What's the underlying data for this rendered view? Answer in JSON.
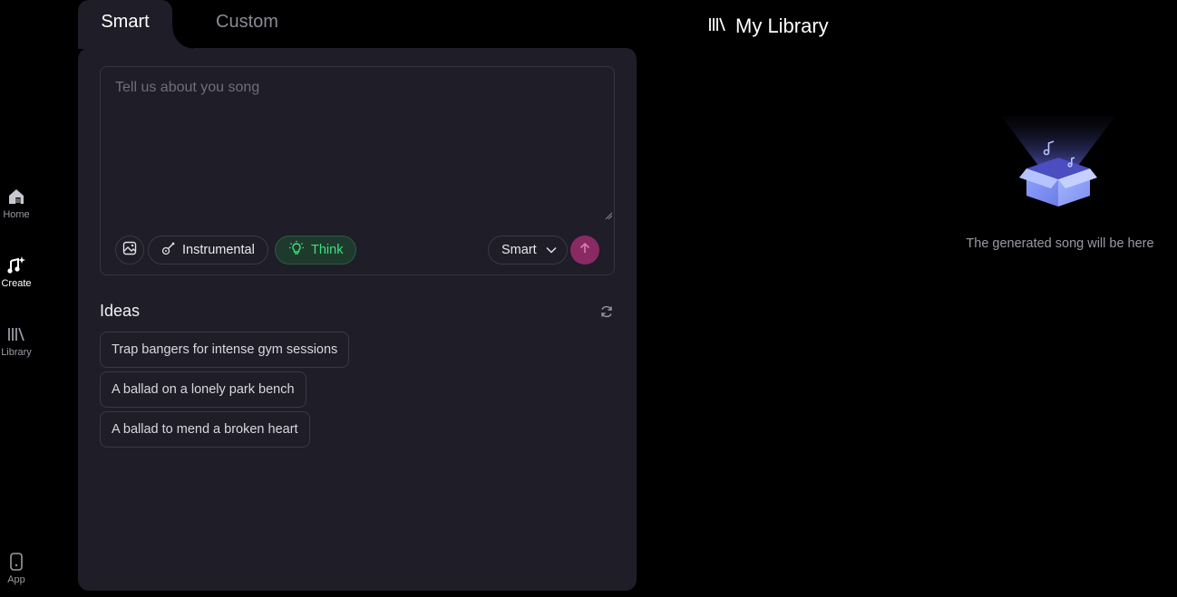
{
  "sidebar": {
    "items": [
      {
        "label": "Home",
        "icon": "home-icon"
      },
      {
        "label": "Create",
        "icon": "music-sparkle-icon",
        "active": true
      },
      {
        "label": "Library",
        "icon": "library-icon"
      },
      {
        "label": "App",
        "icon": "phone-icon"
      }
    ]
  },
  "tabs": {
    "smart": "Smart",
    "custom": "Custom",
    "active": "Smart"
  },
  "prompt": {
    "placeholder": "Tell us about you song",
    "value": ""
  },
  "toolbar": {
    "image_icon": "image-icon",
    "instrumental_label": "Instrumental",
    "think_label": "Think",
    "mode_label": "Smart",
    "send_icon": "arrow-up-icon"
  },
  "ideas": {
    "title": "Ideas",
    "items": [
      "Trap bangers for intense gym sessions",
      "A ballad on a lonely park bench",
      "A ballad to mend a broken heart"
    ]
  },
  "library": {
    "title": "My Library",
    "empty_text": "The generated song will be here"
  },
  "colors": {
    "background": "#000000",
    "panel": "#1e1d28",
    "accent_send": "#8a2a64",
    "think_green": "#3ee07f",
    "muted_text": "#9a9aa3"
  }
}
